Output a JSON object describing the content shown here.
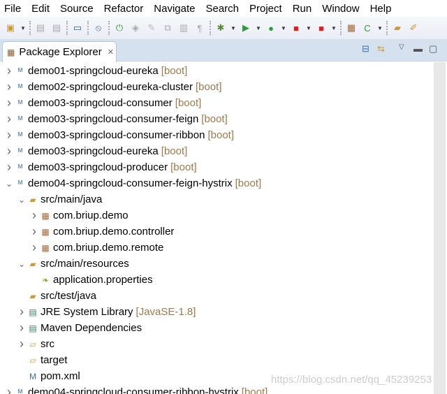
{
  "menu": [
    "File",
    "Edit",
    "Source",
    "Refactor",
    "Navigate",
    "Search",
    "Project",
    "Run",
    "Window",
    "Help"
  ],
  "toolbar_icons": [
    "new-icon",
    "save-icon",
    "save-all-icon",
    "terminal-icon",
    "skip-breakpoints-icon",
    "spring-boot-icon",
    "toggle-mark-icon",
    "edit-icon",
    "compare-icon",
    "block-icon",
    "pilcrow-icon",
    "debug-icon",
    "run-icon",
    "run-server-icon",
    "stop-icon",
    "run-tools-icon",
    "new-package-icon",
    "new-class-icon",
    "open-folder-icon",
    "pen-icon"
  ],
  "view": {
    "title": "Package Explorer"
  },
  "tree": [
    {
      "level": 0,
      "chev": ">",
      "icon": "maven-project",
      "label": "demo01-springcloud-eureka",
      "dec": "[boot]"
    },
    {
      "level": 0,
      "chev": ">",
      "icon": "maven-project",
      "label": "demo02-springcloud-eureka-cluster",
      "dec": "[boot]"
    },
    {
      "level": 0,
      "chev": ">",
      "icon": "maven-project",
      "label": "demo03-springcloud-consumer",
      "dec": "[boot]"
    },
    {
      "level": 0,
      "chev": ">",
      "icon": "maven-project",
      "label": "demo03-springcloud-consumer-feign",
      "dec": "[boot]"
    },
    {
      "level": 0,
      "chev": ">",
      "icon": "maven-project",
      "label": "demo03-springcloud-consumer-ribbon",
      "dec": "[boot]"
    },
    {
      "level": 0,
      "chev": ">",
      "icon": "maven-project",
      "label": "demo03-springcloud-eureka",
      "dec": "[boot]"
    },
    {
      "level": 0,
      "chev": ">",
      "icon": "maven-project",
      "label": "demo03-springcloud-producer",
      "dec": "[boot]"
    },
    {
      "level": 0,
      "chev": "v",
      "icon": "maven-project",
      "label": "demo04-springcloud-consumer-feign-hystrix",
      "dec": "[boot]"
    },
    {
      "level": 1,
      "chev": "v",
      "icon": "source-folder",
      "label": "src/main/java",
      "dec": ""
    },
    {
      "level": 2,
      "chev": ">",
      "icon": "package",
      "label": "com.briup.demo",
      "dec": ""
    },
    {
      "level": 2,
      "chev": ">",
      "icon": "package",
      "label": "com.briup.demo.controller",
      "dec": ""
    },
    {
      "level": 2,
      "chev": ">",
      "icon": "package",
      "label": "com.briup.demo.remote",
      "dec": ""
    },
    {
      "level": 1,
      "chev": "v",
      "icon": "source-folder",
      "label": "src/main/resources",
      "dec": ""
    },
    {
      "level": 2,
      "chev": "",
      "icon": "properties-file",
      "label": "application.properties",
      "dec": ""
    },
    {
      "level": 1,
      "chev": "",
      "icon": "source-folder",
      "label": "src/test/java",
      "dec": ""
    },
    {
      "level": 1,
      "chev": ">",
      "icon": "library",
      "label": "JRE System Library",
      "dec": "[JavaSE-1.8]"
    },
    {
      "level": 1,
      "chev": ">",
      "icon": "library",
      "label": "Maven Dependencies",
      "dec": ""
    },
    {
      "level": 1,
      "chev": ">",
      "icon": "folder",
      "label": "src",
      "dec": ""
    },
    {
      "level": 1,
      "chev": "",
      "icon": "folder",
      "label": "target",
      "dec": ""
    },
    {
      "level": 1,
      "chev": "",
      "icon": "pom-file",
      "label": "pom.xml",
      "dec": ""
    },
    {
      "level": 0,
      "chev": ">",
      "icon": "maven-project",
      "label": "demo04-springcloud-consumer-ribbon-hystrix",
      "dec": "[boot]"
    }
  ],
  "watermark": "https://blog.csdn.net/qq_45239253"
}
